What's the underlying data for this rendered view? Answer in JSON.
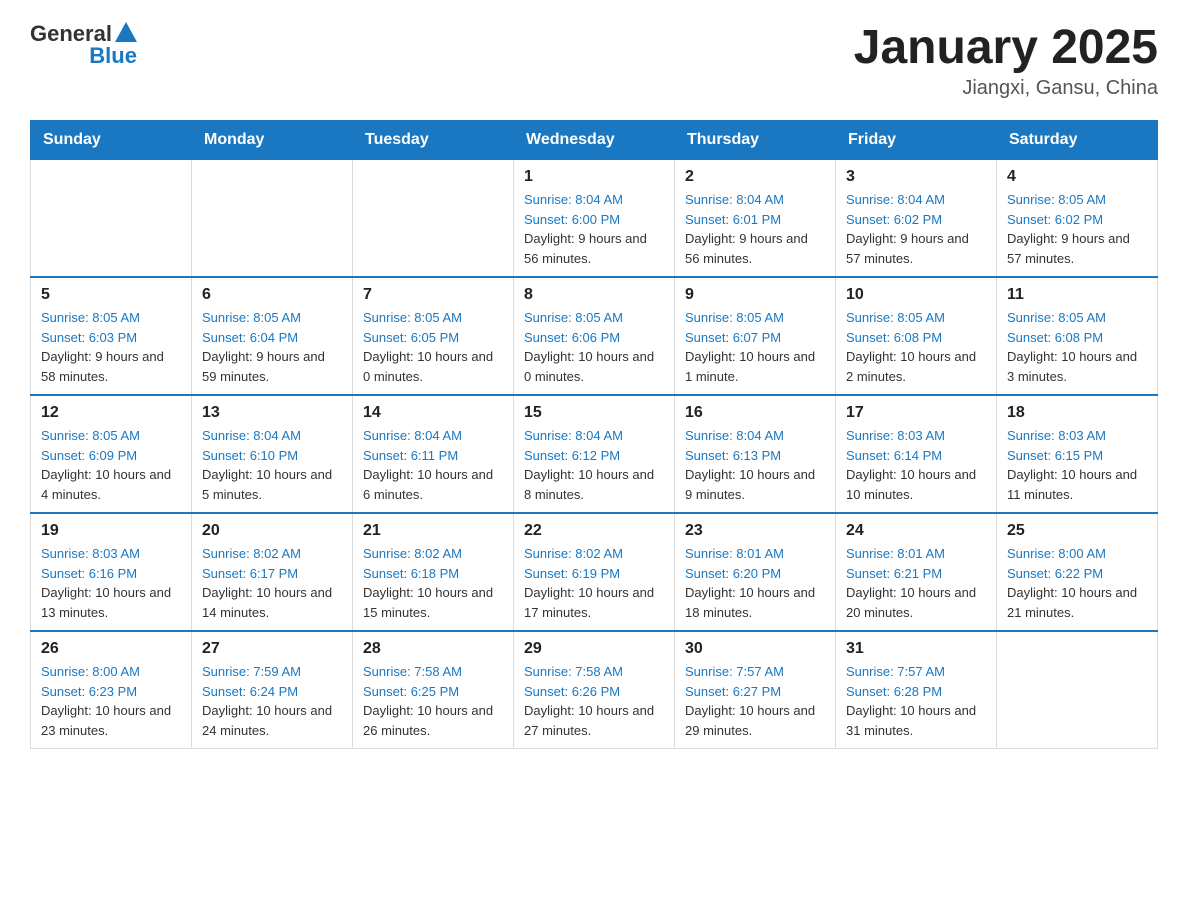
{
  "header": {
    "logo_general": "General",
    "logo_blue": "Blue",
    "title": "January 2025",
    "location": "Jiangxi, Gansu, China"
  },
  "days_of_week": [
    "Sunday",
    "Monday",
    "Tuesday",
    "Wednesday",
    "Thursday",
    "Friday",
    "Saturday"
  ],
  "weeks": [
    [
      {
        "day": "",
        "sunrise": "",
        "sunset": "",
        "daylight": ""
      },
      {
        "day": "",
        "sunrise": "",
        "sunset": "",
        "daylight": ""
      },
      {
        "day": "",
        "sunrise": "",
        "sunset": "",
        "daylight": ""
      },
      {
        "day": "1",
        "sunrise": "Sunrise: 8:04 AM",
        "sunset": "Sunset: 6:00 PM",
        "daylight": "Daylight: 9 hours and 56 minutes."
      },
      {
        "day": "2",
        "sunrise": "Sunrise: 8:04 AM",
        "sunset": "Sunset: 6:01 PM",
        "daylight": "Daylight: 9 hours and 56 minutes."
      },
      {
        "day": "3",
        "sunrise": "Sunrise: 8:04 AM",
        "sunset": "Sunset: 6:02 PM",
        "daylight": "Daylight: 9 hours and 57 minutes."
      },
      {
        "day": "4",
        "sunrise": "Sunrise: 8:05 AM",
        "sunset": "Sunset: 6:02 PM",
        "daylight": "Daylight: 9 hours and 57 minutes."
      }
    ],
    [
      {
        "day": "5",
        "sunrise": "Sunrise: 8:05 AM",
        "sunset": "Sunset: 6:03 PM",
        "daylight": "Daylight: 9 hours and 58 minutes."
      },
      {
        "day": "6",
        "sunrise": "Sunrise: 8:05 AM",
        "sunset": "Sunset: 6:04 PM",
        "daylight": "Daylight: 9 hours and 59 minutes."
      },
      {
        "day": "7",
        "sunrise": "Sunrise: 8:05 AM",
        "sunset": "Sunset: 6:05 PM",
        "daylight": "Daylight: 10 hours and 0 minutes."
      },
      {
        "day": "8",
        "sunrise": "Sunrise: 8:05 AM",
        "sunset": "Sunset: 6:06 PM",
        "daylight": "Daylight: 10 hours and 0 minutes."
      },
      {
        "day": "9",
        "sunrise": "Sunrise: 8:05 AM",
        "sunset": "Sunset: 6:07 PM",
        "daylight": "Daylight: 10 hours and 1 minute."
      },
      {
        "day": "10",
        "sunrise": "Sunrise: 8:05 AM",
        "sunset": "Sunset: 6:08 PM",
        "daylight": "Daylight: 10 hours and 2 minutes."
      },
      {
        "day": "11",
        "sunrise": "Sunrise: 8:05 AM",
        "sunset": "Sunset: 6:08 PM",
        "daylight": "Daylight: 10 hours and 3 minutes."
      }
    ],
    [
      {
        "day": "12",
        "sunrise": "Sunrise: 8:05 AM",
        "sunset": "Sunset: 6:09 PM",
        "daylight": "Daylight: 10 hours and 4 minutes."
      },
      {
        "day": "13",
        "sunrise": "Sunrise: 8:04 AM",
        "sunset": "Sunset: 6:10 PM",
        "daylight": "Daylight: 10 hours and 5 minutes."
      },
      {
        "day": "14",
        "sunrise": "Sunrise: 8:04 AM",
        "sunset": "Sunset: 6:11 PM",
        "daylight": "Daylight: 10 hours and 6 minutes."
      },
      {
        "day": "15",
        "sunrise": "Sunrise: 8:04 AM",
        "sunset": "Sunset: 6:12 PM",
        "daylight": "Daylight: 10 hours and 8 minutes."
      },
      {
        "day": "16",
        "sunrise": "Sunrise: 8:04 AM",
        "sunset": "Sunset: 6:13 PM",
        "daylight": "Daylight: 10 hours and 9 minutes."
      },
      {
        "day": "17",
        "sunrise": "Sunrise: 8:03 AM",
        "sunset": "Sunset: 6:14 PM",
        "daylight": "Daylight: 10 hours and 10 minutes."
      },
      {
        "day": "18",
        "sunrise": "Sunrise: 8:03 AM",
        "sunset": "Sunset: 6:15 PM",
        "daylight": "Daylight: 10 hours and 11 minutes."
      }
    ],
    [
      {
        "day": "19",
        "sunrise": "Sunrise: 8:03 AM",
        "sunset": "Sunset: 6:16 PM",
        "daylight": "Daylight: 10 hours and 13 minutes."
      },
      {
        "day": "20",
        "sunrise": "Sunrise: 8:02 AM",
        "sunset": "Sunset: 6:17 PM",
        "daylight": "Daylight: 10 hours and 14 minutes."
      },
      {
        "day": "21",
        "sunrise": "Sunrise: 8:02 AM",
        "sunset": "Sunset: 6:18 PM",
        "daylight": "Daylight: 10 hours and 15 minutes."
      },
      {
        "day": "22",
        "sunrise": "Sunrise: 8:02 AM",
        "sunset": "Sunset: 6:19 PM",
        "daylight": "Daylight: 10 hours and 17 minutes."
      },
      {
        "day": "23",
        "sunrise": "Sunrise: 8:01 AM",
        "sunset": "Sunset: 6:20 PM",
        "daylight": "Daylight: 10 hours and 18 minutes."
      },
      {
        "day": "24",
        "sunrise": "Sunrise: 8:01 AM",
        "sunset": "Sunset: 6:21 PM",
        "daylight": "Daylight: 10 hours and 20 minutes."
      },
      {
        "day": "25",
        "sunrise": "Sunrise: 8:00 AM",
        "sunset": "Sunset: 6:22 PM",
        "daylight": "Daylight: 10 hours and 21 minutes."
      }
    ],
    [
      {
        "day": "26",
        "sunrise": "Sunrise: 8:00 AM",
        "sunset": "Sunset: 6:23 PM",
        "daylight": "Daylight: 10 hours and 23 minutes."
      },
      {
        "day": "27",
        "sunrise": "Sunrise: 7:59 AM",
        "sunset": "Sunset: 6:24 PM",
        "daylight": "Daylight: 10 hours and 24 minutes."
      },
      {
        "day": "28",
        "sunrise": "Sunrise: 7:58 AM",
        "sunset": "Sunset: 6:25 PM",
        "daylight": "Daylight: 10 hours and 26 minutes."
      },
      {
        "day": "29",
        "sunrise": "Sunrise: 7:58 AM",
        "sunset": "Sunset: 6:26 PM",
        "daylight": "Daylight: 10 hours and 27 minutes."
      },
      {
        "day": "30",
        "sunrise": "Sunrise: 7:57 AM",
        "sunset": "Sunset: 6:27 PM",
        "daylight": "Daylight: 10 hours and 29 minutes."
      },
      {
        "day": "31",
        "sunrise": "Sunrise: 7:57 AM",
        "sunset": "Sunset: 6:28 PM",
        "daylight": "Daylight: 10 hours and 31 minutes."
      },
      {
        "day": "",
        "sunrise": "",
        "sunset": "",
        "daylight": ""
      }
    ]
  ]
}
